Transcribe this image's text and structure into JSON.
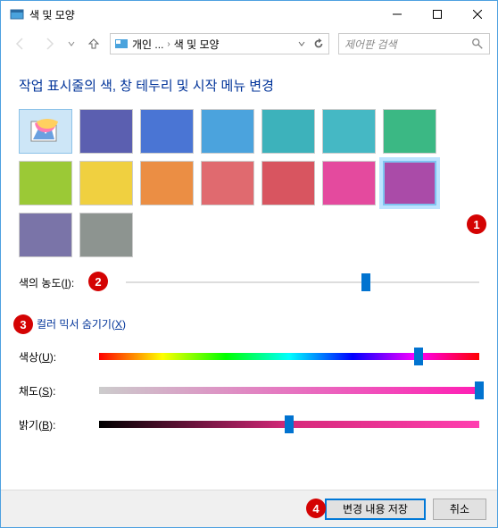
{
  "window": {
    "title": "색 및 모양"
  },
  "breadcrumb": {
    "item1": "개인 ...",
    "item2": "색 및 모양"
  },
  "search": {
    "placeholder": "제어판 검색"
  },
  "heading": "작업 표시줄의 색, 창 테두리 및 시작 메뉴 변경",
  "swatches": [
    {
      "name": "auto",
      "color": "auto"
    },
    {
      "name": "indigo",
      "color": "#5b5fb0"
    },
    {
      "name": "blue",
      "color": "#4a75d4"
    },
    {
      "name": "sky",
      "color": "#4ba3dd"
    },
    {
      "name": "teal",
      "color": "#3db2bb"
    },
    {
      "name": "cyan",
      "color": "#45b8c4"
    },
    {
      "name": "green",
      "color": "#3bb884"
    },
    {
      "name": "lime",
      "color": "#9bc936"
    },
    {
      "name": "yellow",
      "color": "#f0d040"
    },
    {
      "name": "orange",
      "color": "#eb8e44"
    },
    {
      "name": "pink",
      "color": "#e06a6f"
    },
    {
      "name": "red",
      "color": "#d85560"
    },
    {
      "name": "magenta",
      "color": "#e44a9e"
    },
    {
      "name": "purple",
      "color": "#aa4ba8",
      "selected": true
    },
    {
      "name": "violet",
      "color": "#7a74a8"
    },
    {
      "name": "gray",
      "color": "#8d9490"
    }
  ],
  "intensity": {
    "label_pre": "색의 농도(",
    "label_key": "I",
    "label_post": "):",
    "value": 68
  },
  "mixer_toggle": {
    "label_pre": "컬러 믹서 숨기기(",
    "label_key": "X",
    "label_post": ")"
  },
  "hue": {
    "label_pre": "색상(",
    "label_key": "U",
    "label_post": "):",
    "value": 84
  },
  "saturation": {
    "label_pre": "채도(",
    "label_key": "S",
    "label_post": "):",
    "value": 100
  },
  "brightness": {
    "label_pre": "밝기(",
    "label_key": "B",
    "label_post": "):",
    "value": 50
  },
  "buttons": {
    "save": "변경 내용 저장",
    "cancel": "취소"
  },
  "markers": {
    "m1": "1",
    "m2": "2",
    "m3": "3",
    "m4": "4"
  }
}
